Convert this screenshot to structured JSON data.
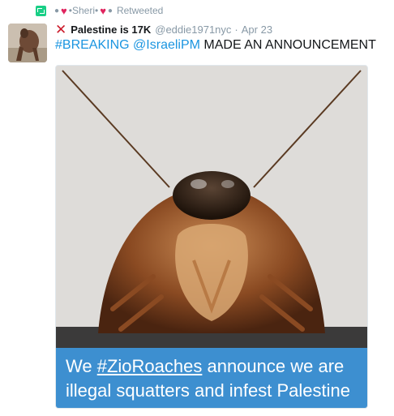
{
  "retweet": {
    "name": "•Sheri•",
    "label": "Retweeted"
  },
  "tweet": {
    "display_name": "Palestine is 17K",
    "handle": "@eddie1971nyc",
    "separator": "·",
    "time": "Apr 23",
    "hashtag": "#BREAKING",
    "mention": "@IsraeliPM",
    "body": " MADE AN ANNOUNCEMENT"
  },
  "media": {
    "caption_prefix": "We ",
    "caption_hashtag": "#ZioRoaches",
    "caption_line1_rest": " announce we are",
    "caption_line2": "illegal squatters and infest Palestine"
  },
  "colors": {
    "link": "#1b95e0",
    "caption_bg": "#3d8fd0",
    "retweet_icon": "#19cf86",
    "heart": "#e0245e"
  }
}
